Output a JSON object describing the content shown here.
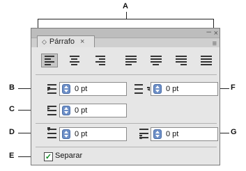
{
  "callouts": {
    "a": "A",
    "b": "B",
    "c": "C",
    "d": "D",
    "e": "E",
    "f": "F",
    "g": "G"
  },
  "panel": {
    "tab_label": "Párrafo",
    "tab_close": "×",
    "window_close": "×",
    "window_minimize": "–",
    "panel_menu": "≡",
    "align_buttons": [
      "align-left",
      "align-center",
      "align-right",
      "justify-last-left",
      "justify-last-center",
      "justify-last-right",
      "justify-all"
    ],
    "left_indent": {
      "value": "0 pt",
      "icon": "left-indent-icon"
    },
    "right_indent": {
      "value": "0 pt",
      "icon": "right-indent-icon"
    },
    "first_line_indent": {
      "value": "0 pt",
      "icon": "first-line-indent-icon"
    },
    "space_before": {
      "value": "0 pt",
      "icon": "space-before-icon"
    },
    "space_after": {
      "value": "0 pt",
      "icon": "space-after-icon"
    },
    "hyphenate": {
      "label": "Separar",
      "checked": true
    }
  }
}
